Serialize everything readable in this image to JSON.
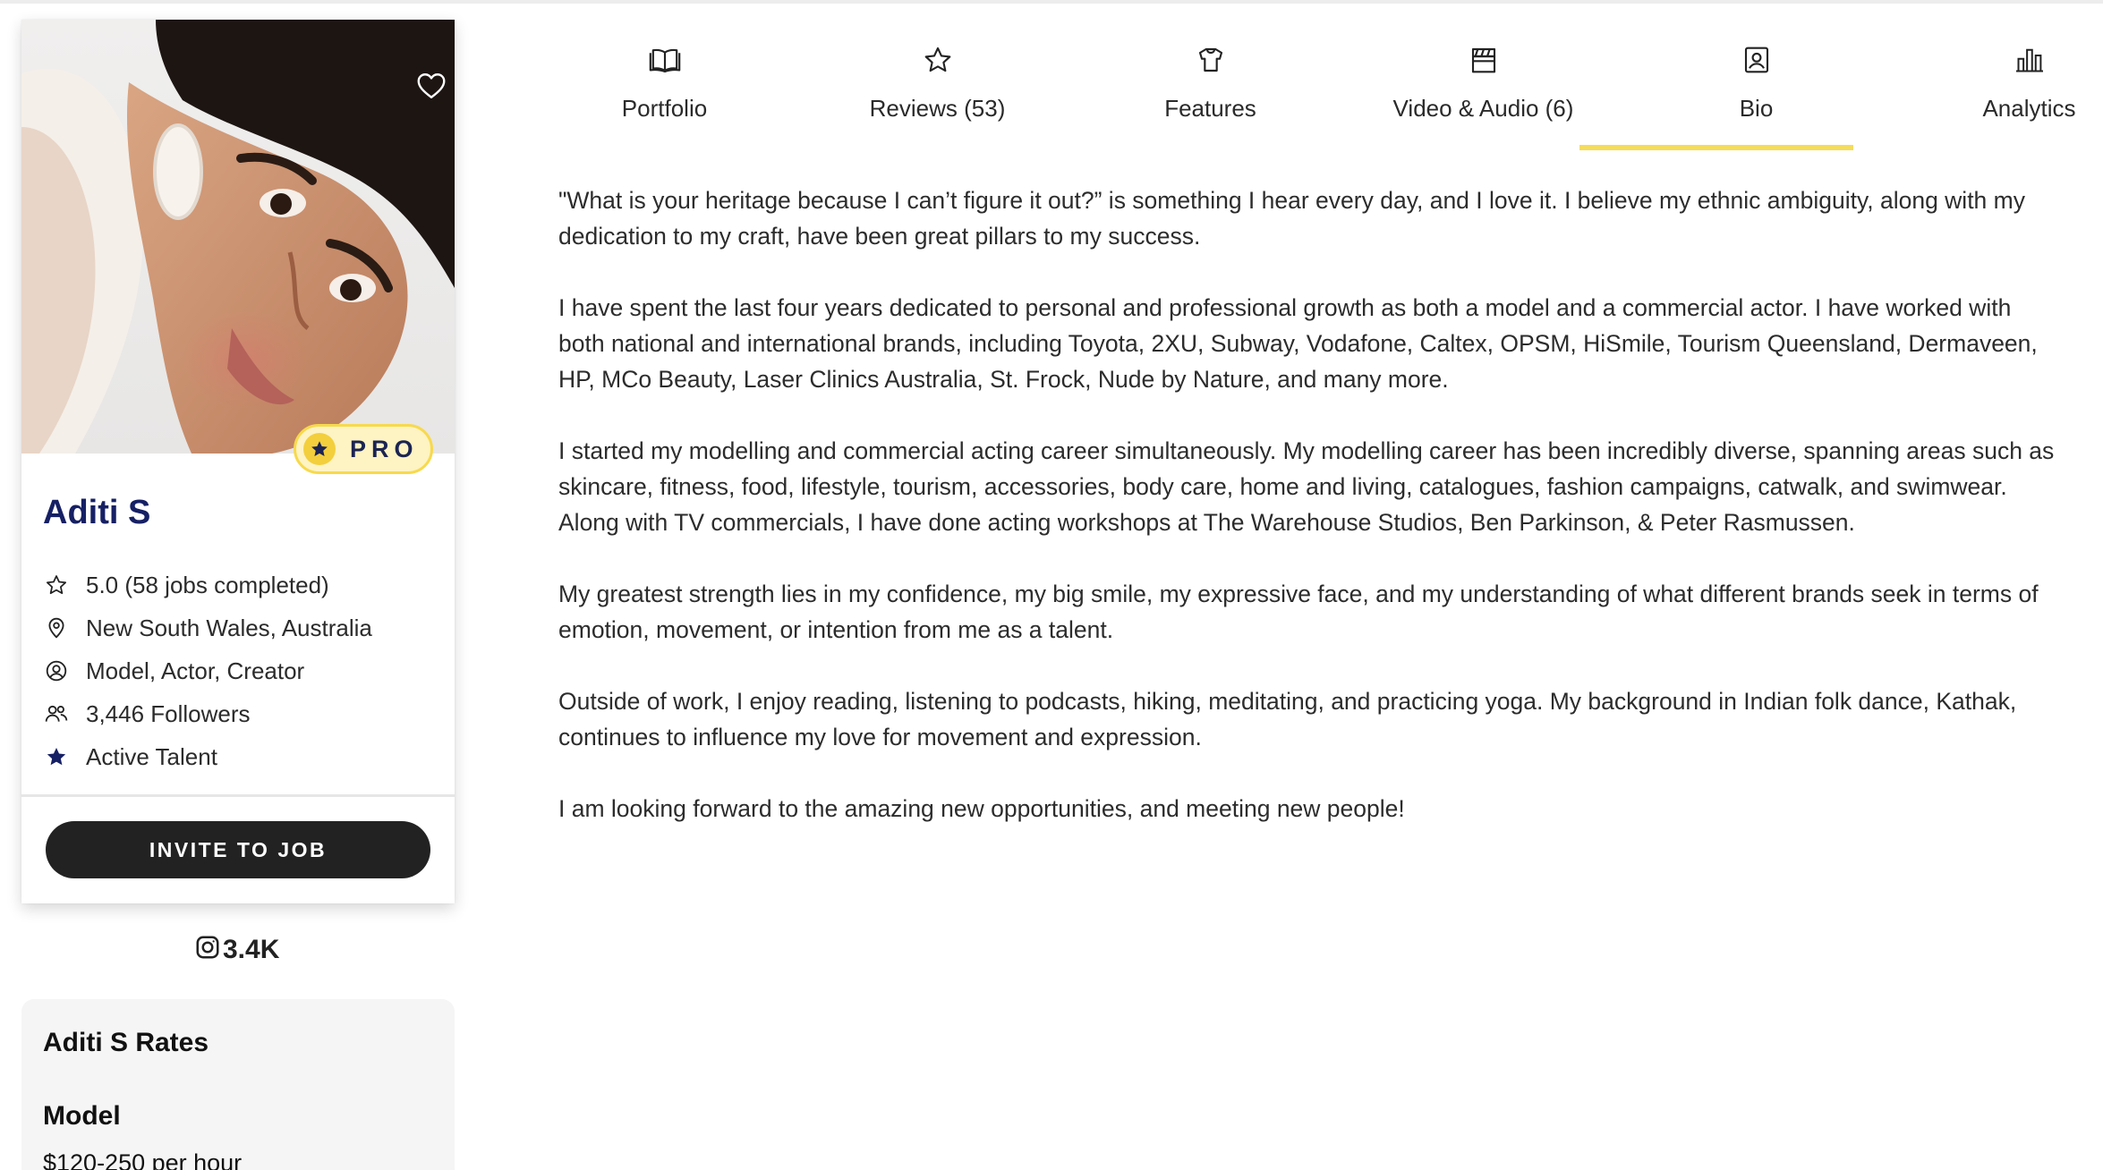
{
  "profile": {
    "name": "Aditi S",
    "pro_label": "PRO",
    "stats": [
      {
        "icon": "star-outline-icon",
        "text": "5.0 (58 jobs completed)"
      },
      {
        "icon": "location-pin-icon",
        "text": "New South Wales, Australia"
      },
      {
        "icon": "user-circle-icon",
        "text": "Model, Actor, Creator"
      },
      {
        "icon": "users-icon",
        "text": "3,446 Followers"
      },
      {
        "icon": "star-filled-icon",
        "text": "Active Talent"
      }
    ],
    "invite_label": "INVITE TO JOB",
    "instagram_count": "3.4K"
  },
  "rates": {
    "title": "Aditi S Rates",
    "role": "Model",
    "range": "$120-250 per hour"
  },
  "tabs": [
    {
      "icon": "book-icon",
      "label": "Portfolio"
    },
    {
      "icon": "star-outline-icon",
      "label": "Reviews (53)"
    },
    {
      "icon": "shirt-icon",
      "label": "Features"
    },
    {
      "icon": "clapperboard-icon",
      "label": "Video & Audio (6)"
    },
    {
      "icon": "id-badge-icon",
      "label": "Bio",
      "active": true
    },
    {
      "icon": "bar-chart-icon",
      "label": "Analytics"
    }
  ],
  "bio": [
    "\"What is your heritage because I can’t figure it out?” is something I hear every day, and I love it. I believe my ethnic ambiguity, along with my dedication to my craft, have been great pillars to my success.",
    "I have spent the last four years dedicated to personal and professional growth as both a model and a commercial actor. I have worked with both national and international brands, including Toyota, 2XU, Subway, Vodafone, Caltex, OPSM, HiSmile, Tourism Queensland, Dermaveen, HP, MCo Beauty, Laser Clinics Australia, St. Frock, Nude by Nature, and many more.",
    "I started my modelling and commercial acting career simultaneously. My modelling career has been incredibly diverse, spanning areas such as skincare, fitness, food, lifestyle, tourism, accessories, body care, home and living, catalogues, fashion campaigns, catwalk, and swimwear. Along with TV commercials, I have done acting workshops at The Warehouse Studios, Ben Parkinson, & Peter Rasmussen.",
    "My greatest strength lies in my confidence, my big smile, my expressive face, and my understanding of what different brands seek in terms of emotion, movement, or intention from me as a talent.",
    "Outside of work, I enjoy reading, listening to podcasts, hiking, meditating, and practicing yoga. My background in Indian folk dance, Kathak, continues to influence my love for movement and expression.",
    "I am looking forward to the amazing new opportunities, and meeting new people!"
  ],
  "colors": {
    "name": "#162064",
    "pro_badge_bg": "#fdf3c3",
    "pro_badge_border": "#f7d94c",
    "tab_active_underline": "#f5dc5a",
    "invite_button": "#222222",
    "rates_panel_bg": "#f5f5f5"
  }
}
